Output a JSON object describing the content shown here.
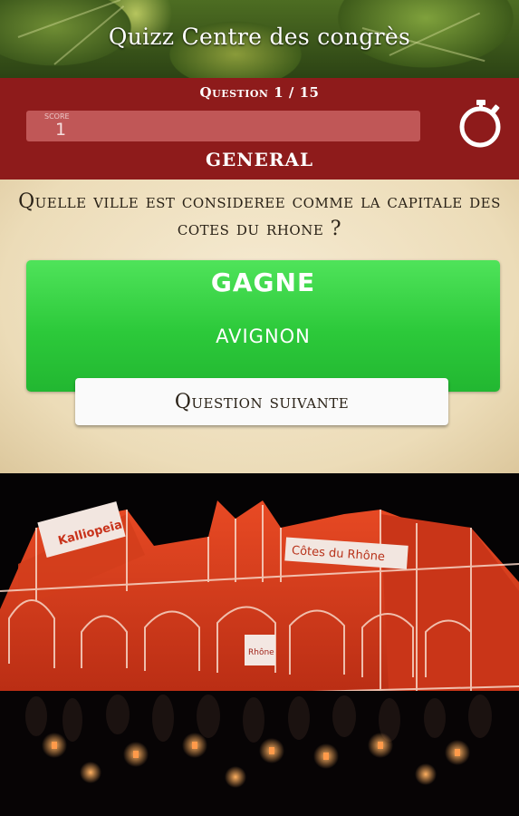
{
  "header": {
    "title": "Quizz Centre des congrès"
  },
  "quiz": {
    "question_counter": "Question 1 / 15",
    "score_label": "SCORE",
    "score_value": "1",
    "category": "GENERAL",
    "question_text": "Quelle ville est consideree comme la capitale des cotes du rhone ?"
  },
  "result": {
    "status": "GAGNE",
    "answer": "AVIGNON",
    "next_button_label": "Question suivante"
  },
  "photo": {
    "banner_left": "Kalliopeia",
    "banner_right": "Côtes du Rhône",
    "panel_text": "Rhône"
  },
  "colors": {
    "header_red": "#8e1b1b",
    "score_box": "#c05757",
    "success_green": "#2cc93a",
    "parchment": "#ecdcb8",
    "projection_red": "#d8361c"
  },
  "icons": {
    "timer": "stopwatch-icon"
  }
}
